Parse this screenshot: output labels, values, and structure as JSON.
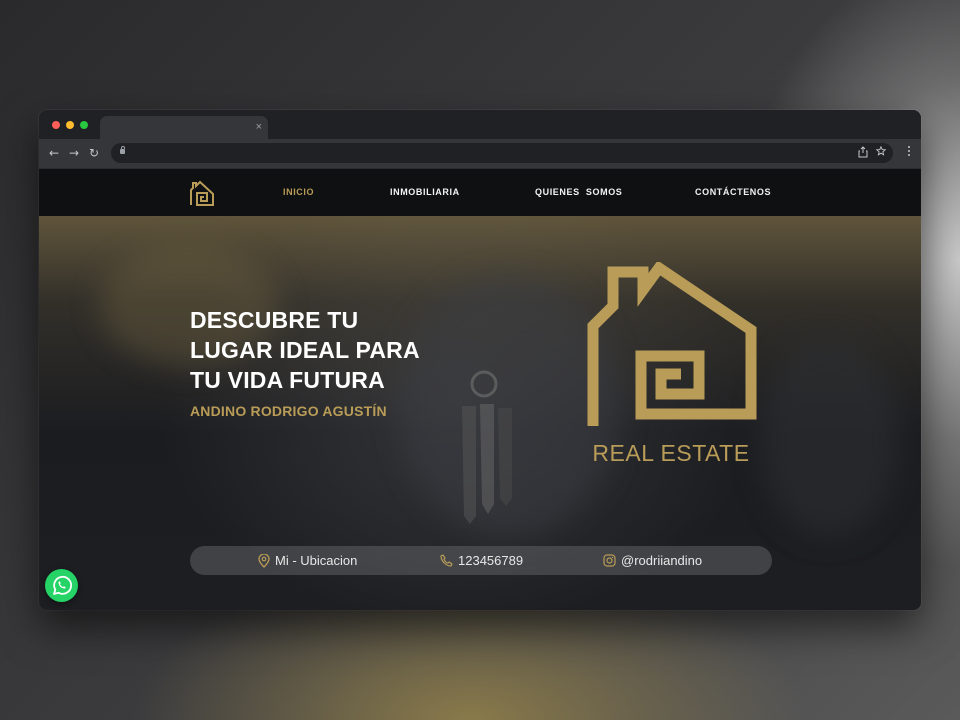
{
  "browser": {
    "window_controls": [
      "close",
      "minimize",
      "maximize"
    ],
    "colors": {
      "close": "#ff5f57",
      "minimize": "#febc2e",
      "maximize": "#28c840"
    },
    "tab_close_glyph": "×",
    "nav_glyphs": {
      "back": "←",
      "forward": "→",
      "reload": "↻"
    },
    "omnibox_icons": [
      "share-icon",
      "star-icon"
    ]
  },
  "site": {
    "nav": {
      "items": [
        {
          "label": "INICIO",
          "active": true
        },
        {
          "label": "INMOBILIARIA",
          "active": false
        },
        {
          "label": "QUIENES  SOMOS",
          "active": false
        },
        {
          "label": "CONTÁCTENOS",
          "active": false
        }
      ]
    },
    "hero": {
      "title_lines": [
        "DESCUBRE TU",
        "LUGAR IDEAL PARA",
        "TU VIDA FUTURA"
      ],
      "subtitle": "ANDINO RODRIGO AGUSTÍN",
      "logo_text": "REAL ESTATE"
    },
    "contact": {
      "location": "Mi - Ubicacion",
      "phone": "123456789",
      "instagram": "@rodriiandino"
    }
  },
  "colors": {
    "gold": "#b99c57",
    "nav_bg": "#0f1012",
    "whatsapp": "#25d366"
  }
}
